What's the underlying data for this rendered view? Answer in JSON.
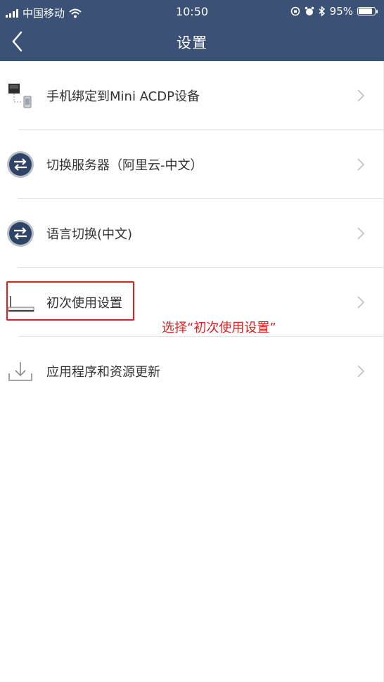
{
  "status_bar": {
    "carrier": "中国移动",
    "time": "10:50",
    "battery": "95%",
    "battery_level": 0.95
  },
  "navbar": {
    "title": "设置",
    "back_icon": "chevron-left-icon"
  },
  "items": [
    {
      "label": "手机绑定到Mini ACDP设备",
      "icon": "phone-device-bind-icon"
    },
    {
      "label": "切换服务器（阿里云-中文）",
      "icon": "swap-arrows-icon"
    },
    {
      "label": "语言切换(中文)",
      "icon": "swap-arrows-icon"
    },
    {
      "label": "初次使用设置",
      "icon": "router-device-icon"
    },
    {
      "label": "应用程序和资源更新",
      "icon": "download-icon"
    }
  ],
  "annotation": {
    "text": "选择“初次使用设置”",
    "color": "#e02020"
  },
  "colors": {
    "header": "#3b5175",
    "highlight": "#e02020"
  }
}
